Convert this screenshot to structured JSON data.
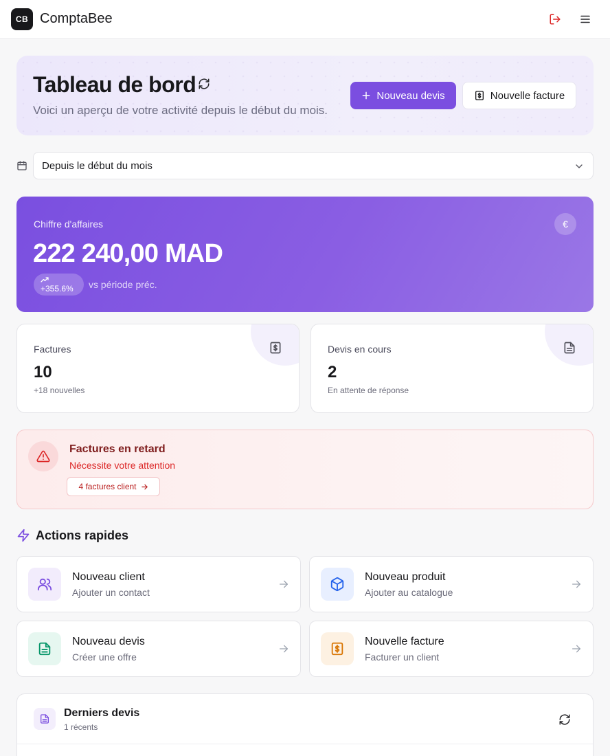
{
  "app": {
    "logo_text": "CB",
    "name": "ComptaBee"
  },
  "header": {
    "logout_icon": "logout-icon",
    "menu_icon": "hamburger-menu-icon"
  },
  "hero": {
    "title": "Tableau de bord",
    "subtitle": "Voici un aperçu de votre activité depuis le début du mois.",
    "new_quote_label": "Nouveau devis",
    "new_invoice_label": "Nouvelle facture"
  },
  "period": {
    "selected": "Depuis le début du mois"
  },
  "revenue": {
    "label": "Chiffre d'affaires",
    "amount": "222 240,00 MAD",
    "change": "+355.6%",
    "comparison": "vs période préc.",
    "currency_symbol": "€"
  },
  "stats": [
    {
      "label": "Factures",
      "value": "10",
      "sub": "+18 nouvelles",
      "icon": "invoice-dollar-icon"
    },
    {
      "label": "Devis en cours",
      "value": "2",
      "sub": "En attente de réponse",
      "icon": "document-icon"
    }
  ],
  "alert": {
    "title": "Factures en retard",
    "subtitle": "Nécessite votre attention",
    "button_label": "4 factures client"
  },
  "quick_actions": {
    "title": "Actions rapides",
    "items": [
      {
        "title": "Nouveau client",
        "subtitle": "Ajouter un contact",
        "icon": "users-icon",
        "color": "#7b4ee0",
        "bg": "#f2ecfc"
      },
      {
        "title": "Nouveau produit",
        "subtitle": "Ajouter au catalogue",
        "icon": "package-icon",
        "color": "#2563eb",
        "bg": "#e8efff"
      },
      {
        "title": "Nouveau devis",
        "subtitle": "Créer une offre",
        "icon": "document-text-icon",
        "color": "#059669",
        "bg": "#e6f7f0"
      },
      {
        "title": "Nouvelle facture",
        "subtitle": "Facturer un client",
        "icon": "receipt-dollar-icon",
        "color": "#d97706",
        "bg": "#fdf1e2"
      }
    ]
  },
  "recent_quotes": {
    "title": "Derniers devis",
    "count": "1 récents"
  },
  "colors": {
    "accent": "#7b4ee0",
    "danger": "#dc2626",
    "danger_dark": "#7f1d1d"
  }
}
